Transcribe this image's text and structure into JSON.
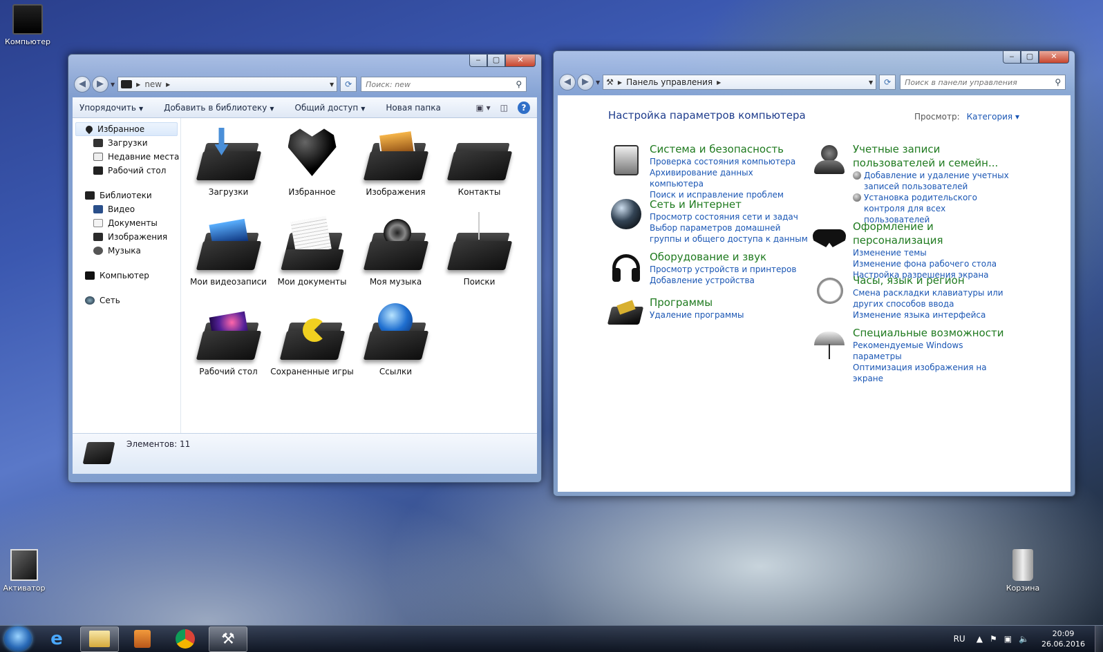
{
  "desktop": {
    "icons": [
      {
        "label": "Компьютер"
      },
      {
        "label": "Активатор"
      },
      {
        "label": "Корзина"
      }
    ]
  },
  "explorer": {
    "address": {
      "path": [
        "new"
      ]
    },
    "search_placeholder": "Поиск: new",
    "toolbar": {
      "organize": "Упорядочить",
      "add_library": "Добавить в библиотеку",
      "share": "Общий доступ",
      "new_folder": "Новая папка"
    },
    "sidebar": {
      "favorites": {
        "label": "Избранное",
        "items": [
          "Загрузки",
          "Недавние места",
          "Рабочий стол"
        ]
      },
      "libraries": {
        "label": "Библиотеки",
        "items": [
          "Видео",
          "Документы",
          "Изображения",
          "Музыка"
        ]
      },
      "computer": "Компьютер",
      "network": "Сеть"
    },
    "items": [
      "Загрузки",
      "Избранное",
      "Изображения",
      "Контакты",
      "Мои видеозаписи",
      "Мои документы",
      "Моя музыка",
      "Поиски",
      "Рабочий стол",
      "Сохраненные игры",
      "Ссылки"
    ],
    "status": "Элементов: 11"
  },
  "control_panel": {
    "address": {
      "path": [
        "Панель управления"
      ]
    },
    "search_placeholder": "Поиск в панели управления",
    "heading": "Настройка параметров компьютера",
    "view_label": "Просмотр:",
    "view_value": "Категория",
    "categories_left": [
      {
        "title": "Система и безопасность",
        "links": [
          "Проверка состояния компьютера",
          "Архивирование данных компьютера",
          "Поиск и исправление проблем"
        ]
      },
      {
        "title": "Сеть и Интернет",
        "links": [
          "Просмотр состояния сети и задач",
          "Выбор параметров домашней группы и общего доступа к данным"
        ]
      },
      {
        "title": "Оборудование и звук",
        "links": [
          "Просмотр устройств и принтеров",
          "Добавление устройства"
        ]
      },
      {
        "title": "Программы",
        "links": [
          "Удаление программы"
        ]
      }
    ],
    "categories_right": [
      {
        "title": "Учетные записи пользователей и семейн...",
        "links": [
          "Добавление и удаление учетных записей пользователей",
          "Установка родительского контроля для всех пользователей"
        ]
      },
      {
        "title": "Оформление и персонализация",
        "links": [
          "Изменение темы",
          "Изменение фона рабочего стола",
          "Настройка разрешения экрана"
        ]
      },
      {
        "title": "Часы, язык и регион",
        "links": [
          "Смена раскладки клавиатуры или других способов ввода",
          "Изменение языка интерфейса"
        ]
      },
      {
        "title": "Специальные возможности",
        "links": [
          "Рекомендуемые Windows параметры",
          "Оптимизация изображения на экране"
        ]
      }
    ]
  },
  "taskbar": {
    "language": "RU",
    "time": "20:09",
    "date": "26.06.2016"
  }
}
